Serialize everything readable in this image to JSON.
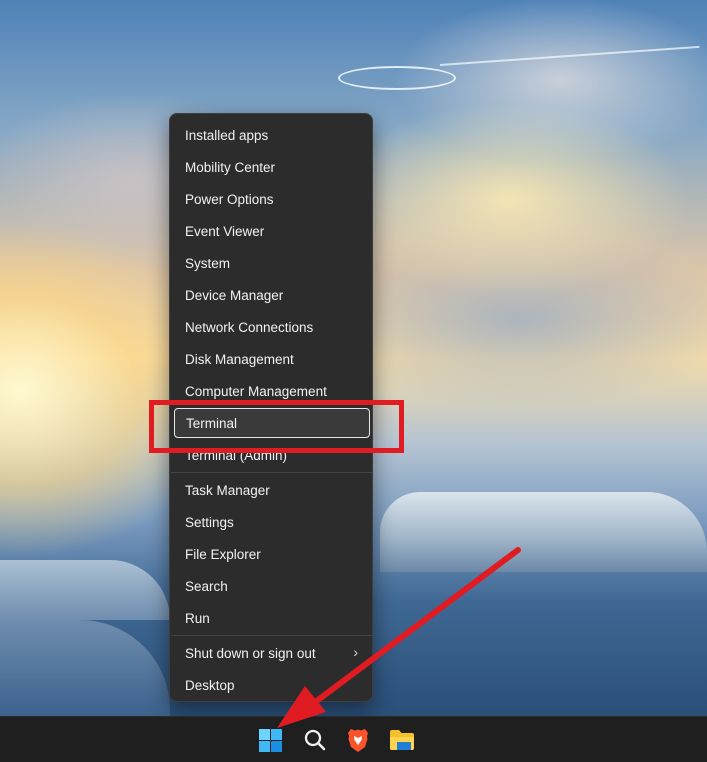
{
  "context_menu": {
    "items": [
      {
        "label": "Installed apps"
      },
      {
        "label": "Mobility Center"
      },
      {
        "label": "Power Options"
      },
      {
        "label": "Event Viewer"
      },
      {
        "label": "System"
      },
      {
        "label": "Device Manager"
      },
      {
        "label": "Network Connections"
      },
      {
        "label": "Disk Management"
      },
      {
        "label": "Computer Management"
      },
      {
        "label": "Terminal",
        "selected": true
      },
      {
        "label": "Terminal (Admin)"
      },
      {
        "label": "Task Manager"
      },
      {
        "label": "Settings"
      },
      {
        "label": "File Explorer"
      },
      {
        "label": "Search"
      },
      {
        "label": "Run"
      },
      {
        "label": "Shut down or sign out",
        "submenu": true,
        "submenu_icon": "chevron-right-icon"
      },
      {
        "label": "Desktop"
      }
    ]
  },
  "annotation": {
    "highlight_color": "#e11b22",
    "arrow_color": "#e11b22"
  },
  "taskbar": {
    "icons": [
      "windows-start-icon",
      "search-icon",
      "brave-browser-icon",
      "file-explorer-icon"
    ],
    "start_accent": "#3fb8f5"
  }
}
